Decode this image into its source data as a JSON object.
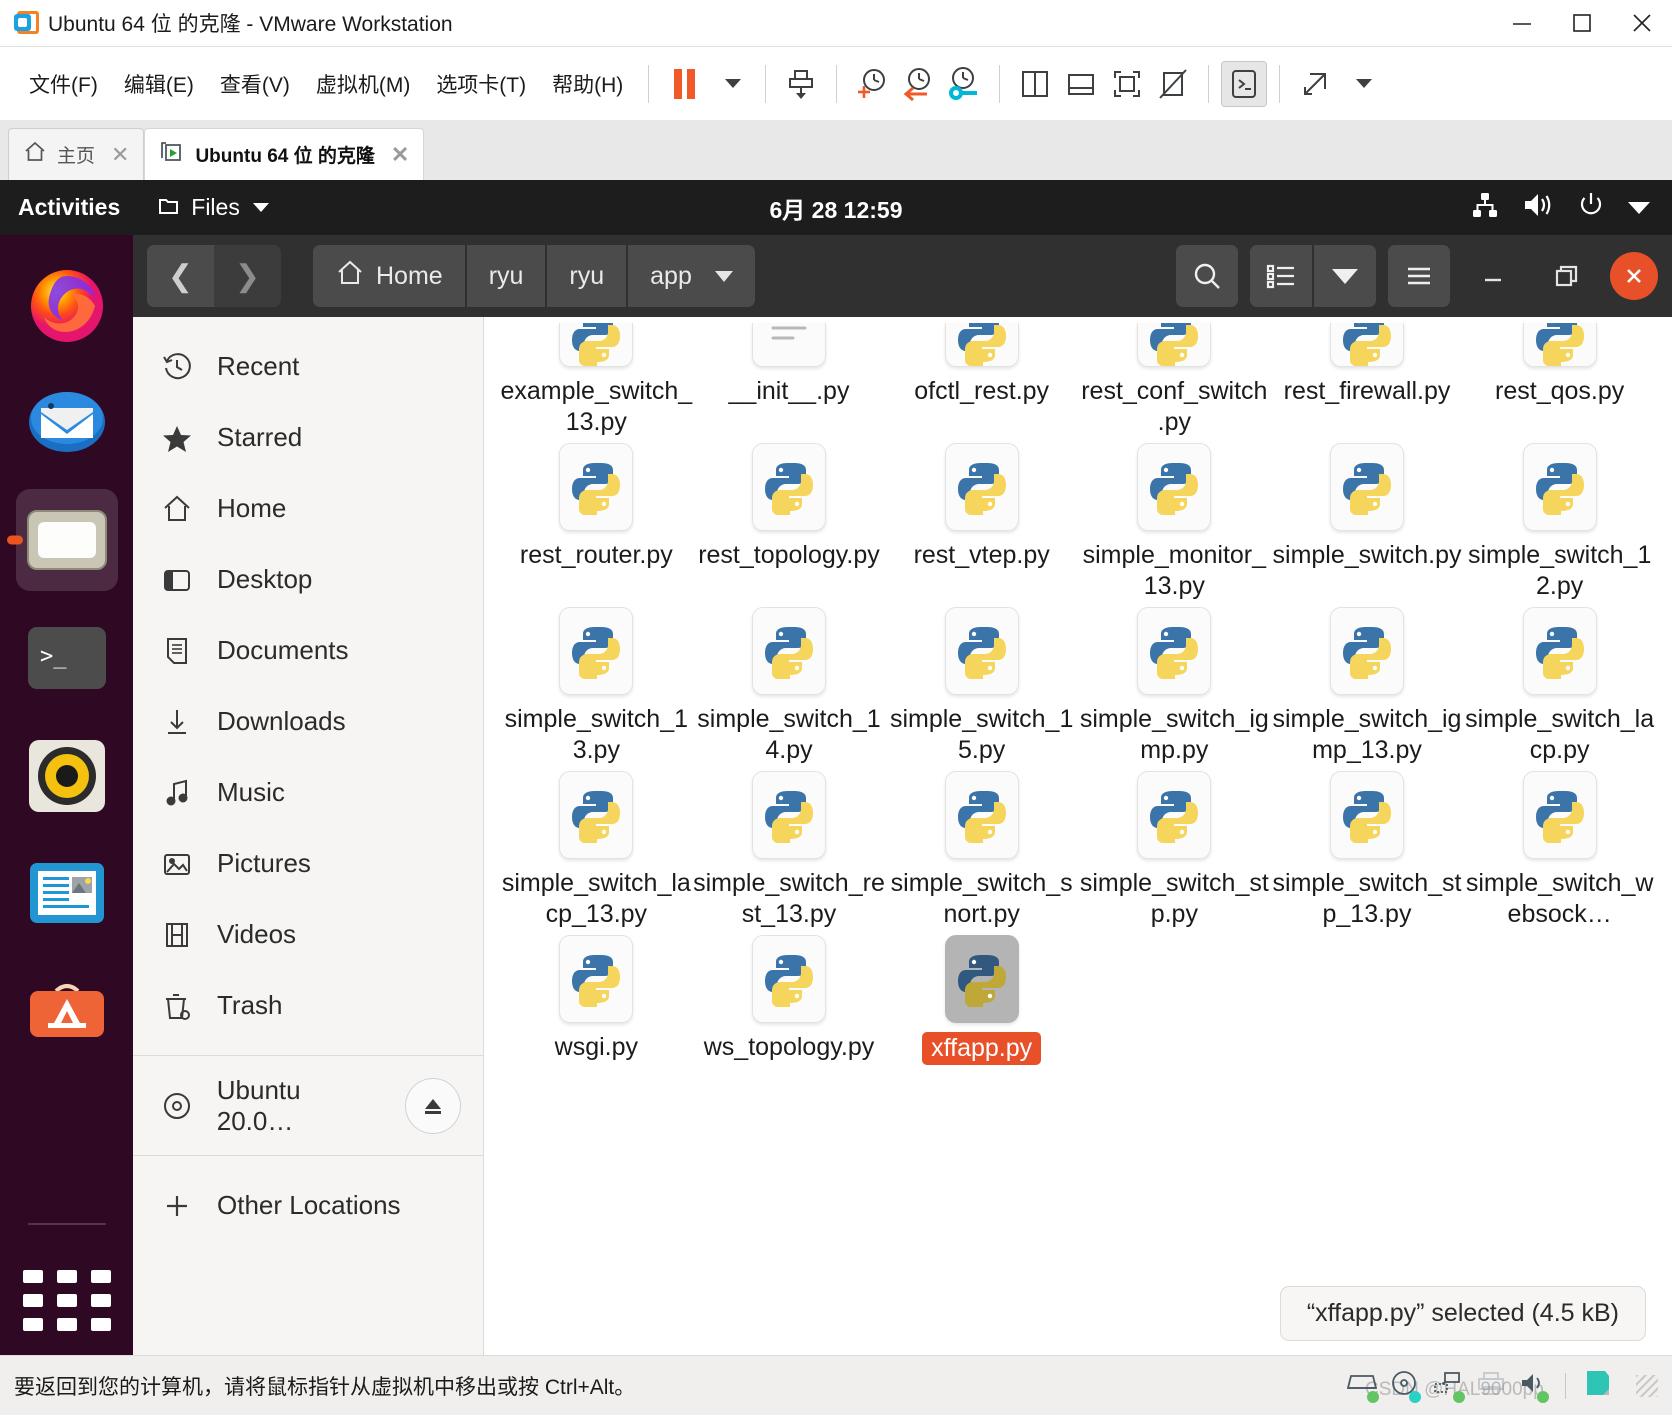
{
  "vmware": {
    "title": "Ubuntu 64 位 的克隆 - VMware Workstation",
    "window_buttons": {
      "minimize": "minimize-icon",
      "maximize": "maximize-icon",
      "close": "close-icon"
    },
    "menus": [
      {
        "label": "文件(F)",
        "name": "menu-file"
      },
      {
        "label": "编辑(E)",
        "name": "menu-edit"
      },
      {
        "label": "查看(V)",
        "name": "menu-view"
      },
      {
        "label": "虚拟机(M)",
        "name": "menu-vm"
      },
      {
        "label": "选项卡(T)",
        "name": "menu-tabs"
      },
      {
        "label": "帮助(H)",
        "name": "menu-help"
      }
    ],
    "toolbar_icons": [
      "pause-icon",
      "dropdown-caret-icon",
      "send-ctrl-alt-del-icon",
      "snapshot-take-icon",
      "snapshot-revert-icon",
      "snapshot-manager-icon",
      "view-sidebyside-icon",
      "view-console-icon",
      "fullscreen-icon",
      "unity-mode-icon",
      "terminal-icon",
      "stretch-icon"
    ],
    "tabs": [
      {
        "label": "主页",
        "name": "tab-home",
        "active": false
      },
      {
        "label": "Ubuntu 64 位 的克隆",
        "name": "tab-ubuntu-clone",
        "active": true
      }
    ],
    "status_text": "要返回到您的计算机，请将鼠标指针从虚拟机中移出或按 Ctrl+Alt。",
    "status_icons": [
      "harddisk-icon",
      "cdrom-icon",
      "network-icon",
      "printer-icon",
      "sound-icon",
      "usb-icon"
    ],
    "watermark": "CSDN @HAL9000pp"
  },
  "gnome": {
    "activities": "Activities",
    "app_menu": "Files",
    "clock": "6月 28  12:59",
    "tray_icons": [
      "network-wired-icon",
      "volume-icon",
      "power-icon",
      "chevron-down-icon"
    ]
  },
  "dock": {
    "items": [
      {
        "name": "dock-item-firefox",
        "label": "Firefox"
      },
      {
        "name": "dock-item-thunderbird",
        "label": "Thunderbird"
      },
      {
        "name": "dock-item-files",
        "label": "Files",
        "running": true
      },
      {
        "name": "dock-item-terminal",
        "label": "Terminal"
      },
      {
        "name": "dock-item-rhythmbox",
        "label": "Rhythmbox"
      },
      {
        "name": "dock-item-libreoffice-writer",
        "label": "LibreOffice Writer"
      },
      {
        "name": "dock-item-software",
        "label": "Ubuntu Software"
      }
    ],
    "show_apps": "show-applications-icon"
  },
  "nautilus": {
    "nav": {
      "back": "back-icon",
      "forward": "forward-icon"
    },
    "breadcrumbs": [
      {
        "label": "Home",
        "icon": "home-icon"
      },
      {
        "label": "ryu"
      },
      {
        "label": "ryu"
      },
      {
        "label": "app",
        "has_caret": true
      }
    ],
    "header_buttons": [
      {
        "name": "search-button",
        "icon": "search-icon"
      },
      {
        "name": "view-list-button",
        "icon": "list-view-icon"
      },
      {
        "name": "view-options-button",
        "icon": "chevron-down-icon"
      },
      {
        "name": "main-menu-button",
        "icon": "hamburger-icon"
      },
      {
        "name": "window-minimize-button",
        "icon": "minimize-icon"
      },
      {
        "name": "window-restore-button",
        "icon": "restore-icon"
      },
      {
        "name": "window-close-button",
        "icon": "close-icon"
      }
    ],
    "places": [
      {
        "label": "Recent",
        "icon": "clock-icon"
      },
      {
        "label": "Starred",
        "icon": "star-icon"
      },
      {
        "label": "Home",
        "icon": "home-icon"
      },
      {
        "label": "Desktop",
        "icon": "desktop-icon"
      },
      {
        "label": "Documents",
        "icon": "document-icon"
      },
      {
        "label": "Downloads",
        "icon": "download-icon"
      },
      {
        "label": "Music",
        "icon": "music-note-icon"
      },
      {
        "label": "Pictures",
        "icon": "picture-icon"
      },
      {
        "label": "Videos",
        "icon": "film-icon"
      },
      {
        "label": "Trash",
        "icon": "trash-icon"
      }
    ],
    "devices": [
      {
        "label": "Ubuntu 20.0…",
        "icon": "disc-icon",
        "eject": "eject-icon"
      }
    ],
    "other_locations": {
      "label": "Other Locations",
      "icon": "plus-icon"
    },
    "files": [
      {
        "name": "example_switch_13.py",
        "type": "python",
        "selected": false,
        "clipped_top": true
      },
      {
        "name": "__init__.py",
        "type": "text",
        "selected": false,
        "clipped_top": true
      },
      {
        "name": "ofctl_rest.py",
        "type": "python",
        "selected": false,
        "clipped_top": true
      },
      {
        "name": "rest_conf_switch.py",
        "type": "python",
        "selected": false,
        "clipped_top": true
      },
      {
        "name": "rest_firewall.py",
        "type": "python",
        "selected": false,
        "clipped_top": true
      },
      {
        "name": "rest_qos.py",
        "type": "python",
        "selected": false,
        "clipped_top": true
      },
      {
        "name": "rest_router.py",
        "type": "python",
        "selected": false
      },
      {
        "name": "rest_topology.py",
        "type": "python",
        "selected": false
      },
      {
        "name": "rest_vtep.py",
        "type": "python",
        "selected": false
      },
      {
        "name": "simple_monitor_13.py",
        "type": "python",
        "selected": false
      },
      {
        "name": "simple_switch.py",
        "type": "python",
        "selected": false
      },
      {
        "name": "simple_switch_12.py",
        "type": "python",
        "selected": false
      },
      {
        "name": "simple_switch_13.py",
        "type": "python",
        "selected": false
      },
      {
        "name": "simple_switch_14.py",
        "type": "python",
        "selected": false
      },
      {
        "name": "simple_switch_15.py",
        "type": "python",
        "selected": false
      },
      {
        "name": "simple_switch_igmp.py",
        "type": "python",
        "selected": false
      },
      {
        "name": "simple_switch_igmp_13.py",
        "type": "python",
        "selected": false
      },
      {
        "name": "simple_switch_lacp.py",
        "type": "python",
        "selected": false
      },
      {
        "name": "simple_switch_lacp_13.py",
        "type": "python",
        "selected": false
      },
      {
        "name": "simple_switch_rest_13.py",
        "type": "python",
        "selected": false
      },
      {
        "name": "simple_switch_snort.py",
        "type": "python",
        "selected": false
      },
      {
        "name": "simple_switch_stp.py",
        "type": "python",
        "selected": false
      },
      {
        "name": "simple_switch_stp_13.py",
        "type": "python",
        "selected": false
      },
      {
        "name": "simple_switch_websock…",
        "type": "python",
        "selected": false
      },
      {
        "name": "wsgi.py",
        "type": "python",
        "selected": false
      },
      {
        "name": "ws_topology.py",
        "type": "python",
        "selected": false
      },
      {
        "name": "xffapp.py",
        "type": "python",
        "selected": true
      }
    ],
    "status": "“xffapp.py” selected  (4.5 kB)"
  },
  "colors": {
    "accent_orange": "#e8502a",
    "vmware_orange": "#f05a28",
    "header_dark": "#303030",
    "topbar_dark": "#1d1d1d",
    "sidebar_bg": "#f6f5f4",
    "selection_gray": "#b4b4b4"
  }
}
